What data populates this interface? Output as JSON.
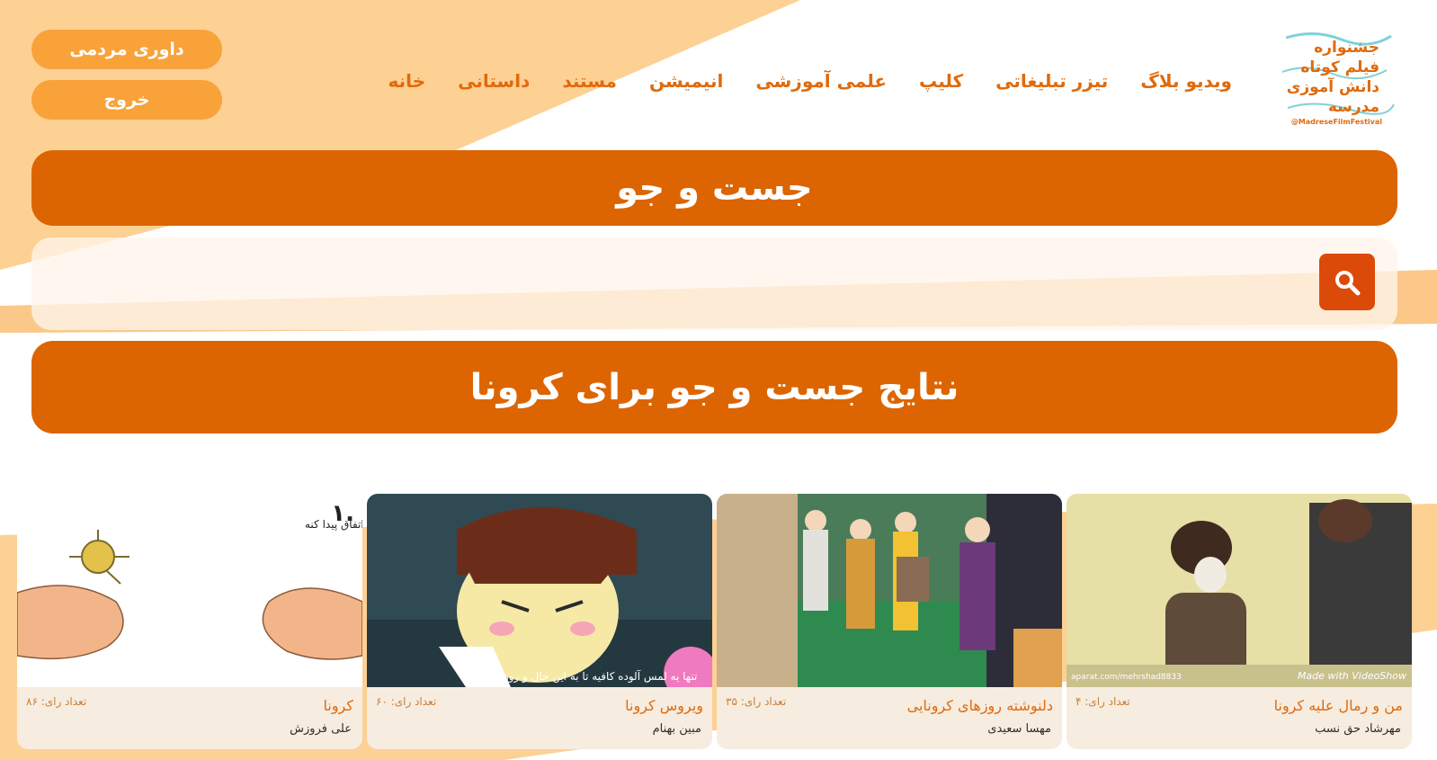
{
  "logo": {
    "lines": [
      "جشنواره",
      "فیلم کوتاه",
      "دانش آموزی",
      "مدرسه"
    ],
    "handle": "@MadreseFilmFestival"
  },
  "nav": {
    "items": [
      {
        "label": "خانه"
      },
      {
        "label": "داستانی"
      },
      {
        "label": "مستند"
      },
      {
        "label": "انیمیشن"
      },
      {
        "label": "علمی آموزشی"
      },
      {
        "label": "کلیپ"
      },
      {
        "label": "تیزر تبلیغاتی"
      },
      {
        "label": "ویدیو بلاگ"
      }
    ]
  },
  "user_actions": {
    "vote_label": "داوری مردمی",
    "logout_label": "خروج"
  },
  "search": {
    "heading": "جست و جو",
    "value": "",
    "button_icon": "search-icon"
  },
  "results": {
    "heading": "نتایج جست و جو برای کرونا",
    "cards": [
      {
        "title": "من و رمال علیه کرونا",
        "votes": "تعداد رای: ۴",
        "author": "مهرشاد حق نسب",
        "watermark_left": "aparat.com/mehrshad8833",
        "watermark_right": "Made with VideoShow"
      },
      {
        "title": "دلنوشته روزهای کرونایی",
        "votes": "تعداد رای: ۳۵",
        "author": "مهسا سعیدی"
      },
      {
        "title": "ویروس کرونا",
        "votes": "تعداد رای: ۶۰",
        "author": "مبین بهنام",
        "subtitle": "تنها یه لمس آلوده کافیه تا به این حال و روز بیوفتین"
      },
      {
        "title": "کرونا",
        "votes": "تعداد رای: ۸۶",
        "author": "علی فروزش",
        "caption_number": "۱.",
        "caption_text": "دستت برید تا اتفاق پیدا کنه"
      }
    ]
  },
  "colors": {
    "primary": "#dc6502",
    "accent_button": "#f9a23a",
    "search_button": "#dc4a0a",
    "background": "#fdd094",
    "nav_text": "#e06a0c"
  }
}
